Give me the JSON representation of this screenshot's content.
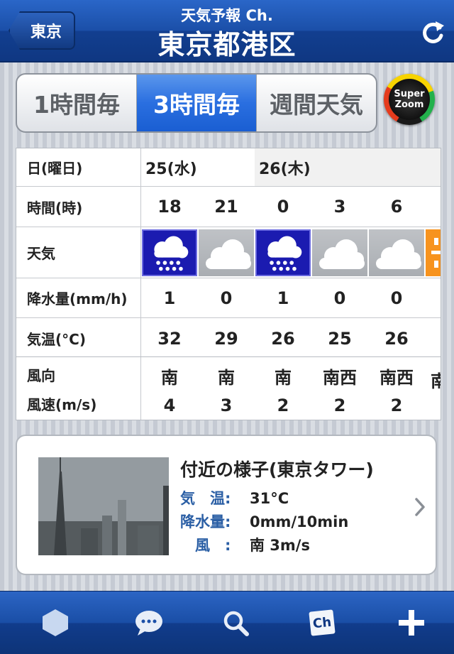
{
  "nav": {
    "back_label": "東京",
    "subtitle": "天気予報 Ch.",
    "title": "東京都港区"
  },
  "segments": [
    {
      "label": "1時間毎",
      "active": false
    },
    {
      "label": "3時間毎",
      "active": true
    },
    {
      "label": "週間天気",
      "active": false
    }
  ],
  "superzoom": {
    "line1": "Super",
    "line2": "Zoom"
  },
  "forecast": {
    "labels": {
      "date": "日(曜日)",
      "time": "時間(時)",
      "weather": "天気",
      "precip": "降水量(mm/h)",
      "temp": "気温(°C)",
      "wind_dir": "風向",
      "wind_speed": "風速(m/s)"
    },
    "dates": [
      "25(水)",
      "26(木)"
    ],
    "columns": [
      {
        "time": "18",
        "weather": "rain",
        "precip": "1",
        "temp": "32",
        "wind_dir": "南",
        "wind_speed": "4"
      },
      {
        "time": "21",
        "weather": "cloud",
        "precip": "0",
        "temp": "29",
        "wind_dir": "南",
        "wind_speed": "3"
      },
      {
        "time": "0",
        "weather": "rain",
        "precip": "1",
        "temp": "26",
        "wind_dir": "南",
        "wind_speed": "2"
      },
      {
        "time": "3",
        "weather": "cloud",
        "precip": "0",
        "temp": "25",
        "wind_dir": "南西",
        "wind_speed": "2"
      },
      {
        "time": "6",
        "weather": "cloud",
        "precip": "0",
        "temp": "26",
        "wind_dir": "南西",
        "wind_speed": "2"
      }
    ],
    "partial_wind_dir": "南"
  },
  "live": {
    "title": "付近の様子(東京タワー)",
    "rows": [
      {
        "key": "気　温:",
        "value": "31°C"
      },
      {
        "key": "降水量:",
        "value": "0mm/10min"
      },
      {
        "key": "　風　:",
        "value": "南 3m/s"
      }
    ]
  },
  "tabs": [
    {
      "icon": "hexagon-icon"
    },
    {
      "icon": "chat-icon"
    },
    {
      "icon": "search-icon"
    },
    {
      "icon": "channel-icon",
      "label": "Ch"
    },
    {
      "icon": "plus-icon"
    }
  ]
}
